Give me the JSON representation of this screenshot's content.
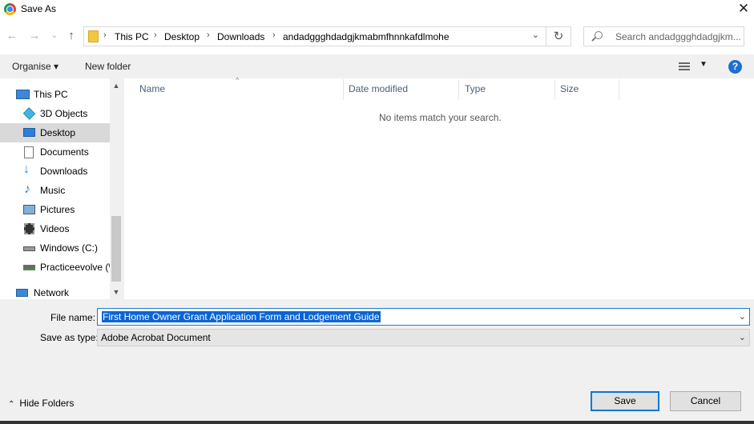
{
  "window": {
    "title": "Save As",
    "close_glyph": "✕"
  },
  "addressbar": {
    "breadcrumbs": [
      "This PC",
      "Desktop",
      "Downloads",
      "andadggghdadgjkmabmfhnnkafdlmohe"
    ],
    "search_placeholder": "Search andadggghdadgjkm..."
  },
  "toolbar": {
    "organise": "Organise ▾",
    "new_folder": "New folder",
    "help": "?"
  },
  "navpane": {
    "items": [
      {
        "label": "This PC",
        "icon": "computer-icon"
      },
      {
        "label": "3D Objects",
        "icon": "cube-icon"
      },
      {
        "label": "Desktop",
        "icon": "desktop-icon",
        "selected": true
      },
      {
        "label": "Documents",
        "icon": "document-icon"
      },
      {
        "label": "Downloads",
        "icon": "download-arrow-icon"
      },
      {
        "label": "Music",
        "icon": "music-note-icon"
      },
      {
        "label": "Pictures",
        "icon": "picture-icon"
      },
      {
        "label": "Videos",
        "icon": "film-icon"
      },
      {
        "label": "Windows (C:)",
        "icon": "drive-icon"
      },
      {
        "label": "Practiceevolve (\\",
        "icon": "network-drive-icon"
      },
      {
        "label": "Network",
        "icon": "network-icon"
      }
    ]
  },
  "filelist": {
    "columns": [
      "Name",
      "Date modified",
      "Type",
      "Size"
    ],
    "empty_message": "No items match your search."
  },
  "form": {
    "file_name_label": "File name:",
    "file_name_value": "First Home Owner Grant Application Form and Lodgement Guide",
    "save_as_type_label": "Save as type:",
    "save_as_type_value": "Adobe Acrobat Document"
  },
  "footer": {
    "hide_folders": "Hide Folders",
    "save": "Save",
    "cancel": "Cancel"
  },
  "colors": {
    "accent": "#0078d7",
    "selection": "#0a64d8",
    "header_text": "#4c607a"
  }
}
